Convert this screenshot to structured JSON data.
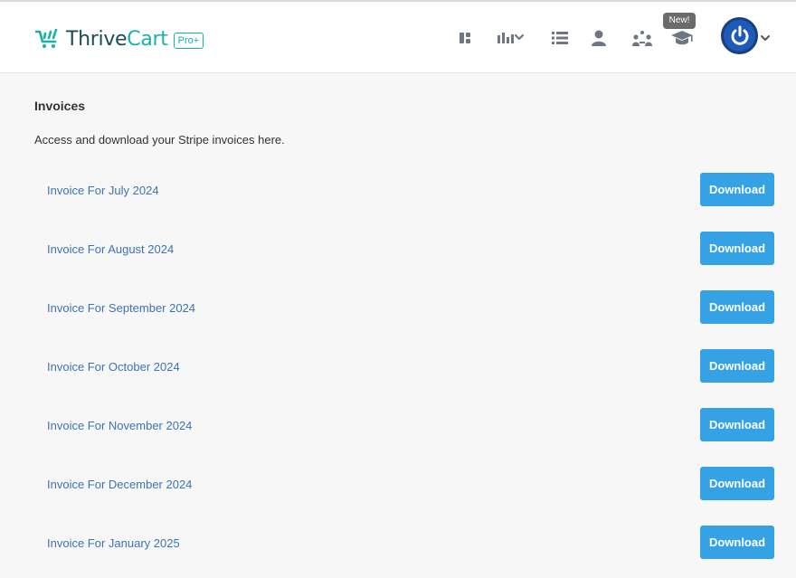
{
  "header": {
    "logo_text_1": "Thrive",
    "logo_text_2": "Cart",
    "logo_badge": "Pro+",
    "new_badge": "New!",
    "brand_color": "#17b2a8"
  },
  "page": {
    "title": "Invoices",
    "description": "Access and download your Stripe invoices here."
  },
  "invoices": [
    {
      "label": "Invoice For July 2024",
      "button": "Download"
    },
    {
      "label": "Invoice For August 2024",
      "button": "Download"
    },
    {
      "label": "Invoice For September 2024",
      "button": "Download"
    },
    {
      "label": "Invoice For October 2024",
      "button": "Download"
    },
    {
      "label": "Invoice For November 2024",
      "button": "Download"
    },
    {
      "label": "Invoice For December 2024",
      "button": "Download"
    },
    {
      "label": "Invoice For January 2025",
      "button": "Download"
    }
  ],
  "colors": {
    "button": "#36a2e6",
    "link": "#3d74b0",
    "avatar": "#1e5ab8"
  }
}
